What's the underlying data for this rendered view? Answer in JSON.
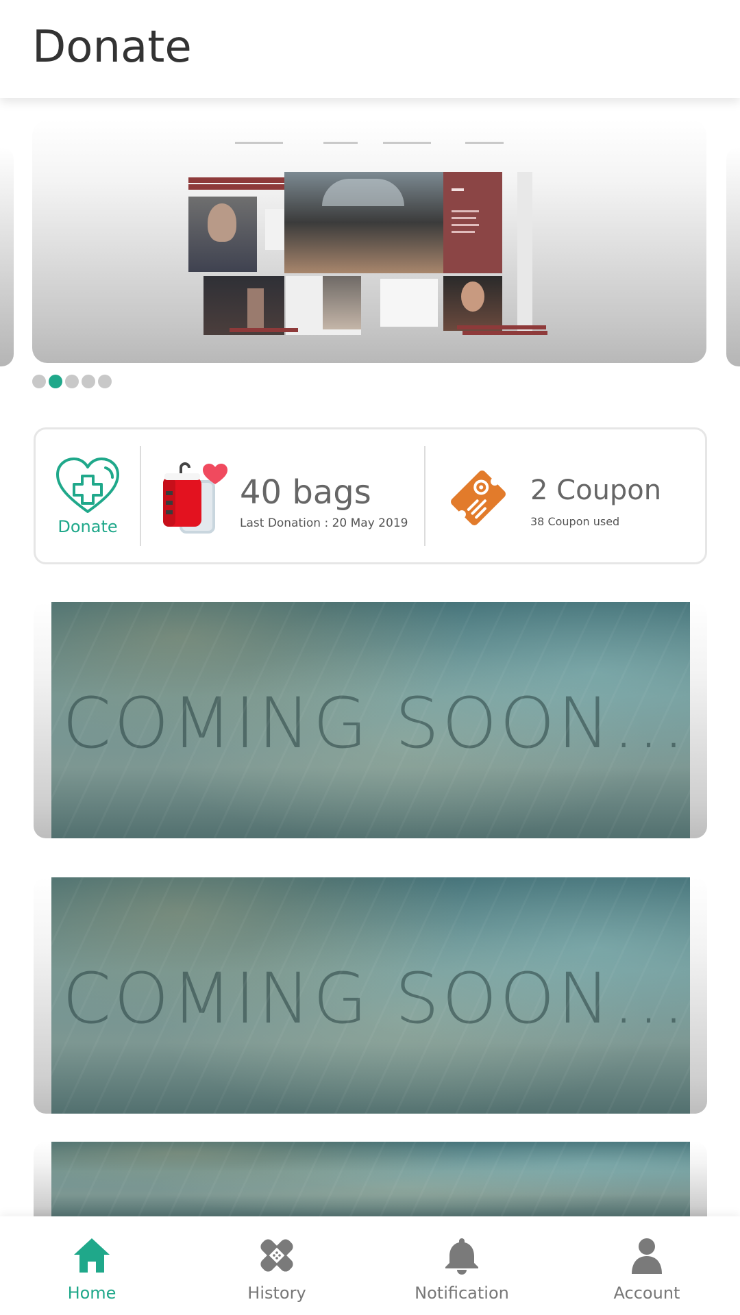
{
  "header": {
    "title": "Donate"
  },
  "carousel": {
    "dot_count": 5,
    "active_index": 1,
    "slide_description_icon": "magazine-collage-image"
  },
  "stats": {
    "donate_label": "Donate",
    "bags_value": "40 bags",
    "last_donation": "Last Donation : 20 May 2019",
    "coupon_value": "2 Coupon",
    "coupon_used": "38 Coupon used"
  },
  "banners": [
    {
      "text": "COMING SOON..."
    },
    {
      "text": "COMING SOON..."
    },
    {
      "text": ""
    }
  ],
  "bottom_nav": {
    "items": [
      {
        "label": "Home",
        "icon": "home-icon",
        "active": true
      },
      {
        "label": "History",
        "icon": "bandage-icon",
        "active": false
      },
      {
        "label": "Notification",
        "icon": "bell-icon",
        "active": false
      },
      {
        "label": "Account",
        "icon": "user-icon",
        "active": false
      }
    ]
  },
  "colors": {
    "accent": "#1fa88a",
    "blood_red": "#e3121f",
    "coupon_orange": "#e27b2b",
    "heart_pink": "#f04a5e"
  }
}
